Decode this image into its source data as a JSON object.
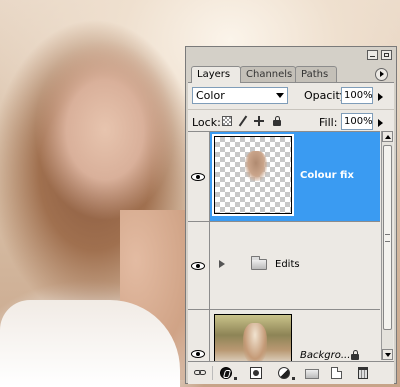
{
  "panel": {
    "tabs": [
      {
        "label": "Layers",
        "active": true
      },
      {
        "label": "Channels",
        "active": false
      },
      {
        "label": "Paths",
        "active": false
      }
    ],
    "blend_mode": "Color",
    "opacity_label": "Opacity:",
    "opacity_value": "100%",
    "lock_label": "Lock:",
    "fill_label": "Fill:",
    "fill_value": "100%",
    "layers": [
      {
        "name": "Colour fix",
        "selected": true,
        "visible": true,
        "type": "layer"
      },
      {
        "name": "Edits",
        "selected": false,
        "visible": true,
        "type": "group",
        "collapsed": true
      },
      {
        "name": "Backgro...",
        "selected": false,
        "visible": true,
        "type": "background",
        "locked": true
      }
    ],
    "colors": {
      "selection": "#3a9bf2",
      "panel_bg": "#ece9e4",
      "frame": "#d4d0c8"
    },
    "bottom_icons": [
      "link-icon",
      "layer-styles-icon",
      "mask-icon",
      "adjustment-icon",
      "group-icon",
      "new-layer-icon",
      "trash-icon"
    ]
  }
}
